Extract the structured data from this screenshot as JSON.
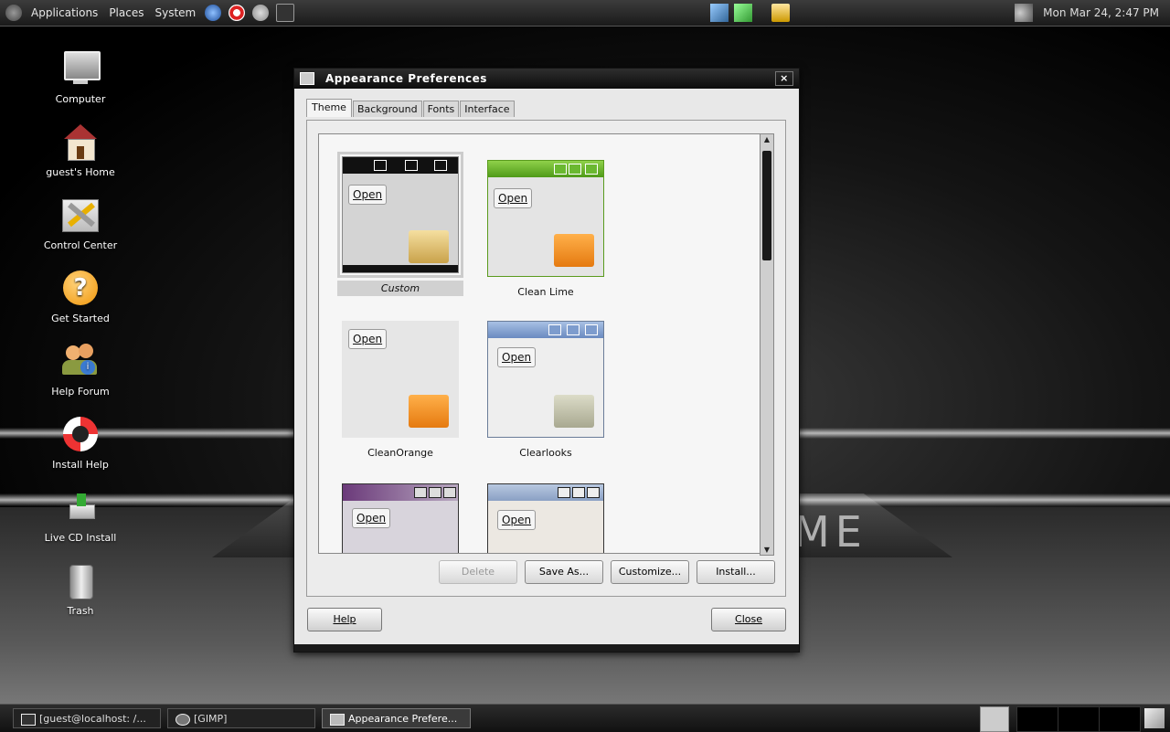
{
  "top_panel": {
    "menus": [
      "Applications",
      "Places",
      "System"
    ],
    "clock": "Mon Mar 24,  2:47 PM"
  },
  "desktop_icons": [
    {
      "label": "Computer",
      "icon": "computer-icon"
    },
    {
      "label": "guest's Home",
      "icon": "home-icon"
    },
    {
      "label": "Control Center",
      "icon": "control-center-icon"
    },
    {
      "label": "Get Started",
      "icon": "help-question-icon"
    },
    {
      "label": "Help Forum",
      "icon": "help-forum-icon"
    },
    {
      "label": "Install Help",
      "icon": "lifebuoy-icon"
    },
    {
      "label": "Live CD Install",
      "icon": "install-icon"
    },
    {
      "label": "Trash",
      "icon": "trash-icon"
    }
  ],
  "window": {
    "title": "Appearance Preferences",
    "close_glyph": "×",
    "tabs": [
      "Theme",
      "Background",
      "Fonts",
      "Interface"
    ],
    "themes": [
      {
        "name": "Custom",
        "open_label": "Open"
      },
      {
        "name": "Clean Lime",
        "open_label": "Open"
      },
      {
        "name": "CleanOrange",
        "open_label": "Open"
      },
      {
        "name": "Clearlooks",
        "open_label": "Open"
      },
      {
        "name": "",
        "open_label": "Open"
      },
      {
        "name": "",
        "open_label": "Open"
      }
    ],
    "buttons": {
      "delete": "Delete",
      "save_as": "Save As...",
      "customize": "Customize...",
      "install": "Install...",
      "help": "Help",
      "close": "Close"
    }
  },
  "bottom_panel": {
    "tasks": [
      "[guest@localhost: /...",
      "[GIMP]",
      "Appearance Prefere..."
    ]
  },
  "wallpaper_text": "ME"
}
